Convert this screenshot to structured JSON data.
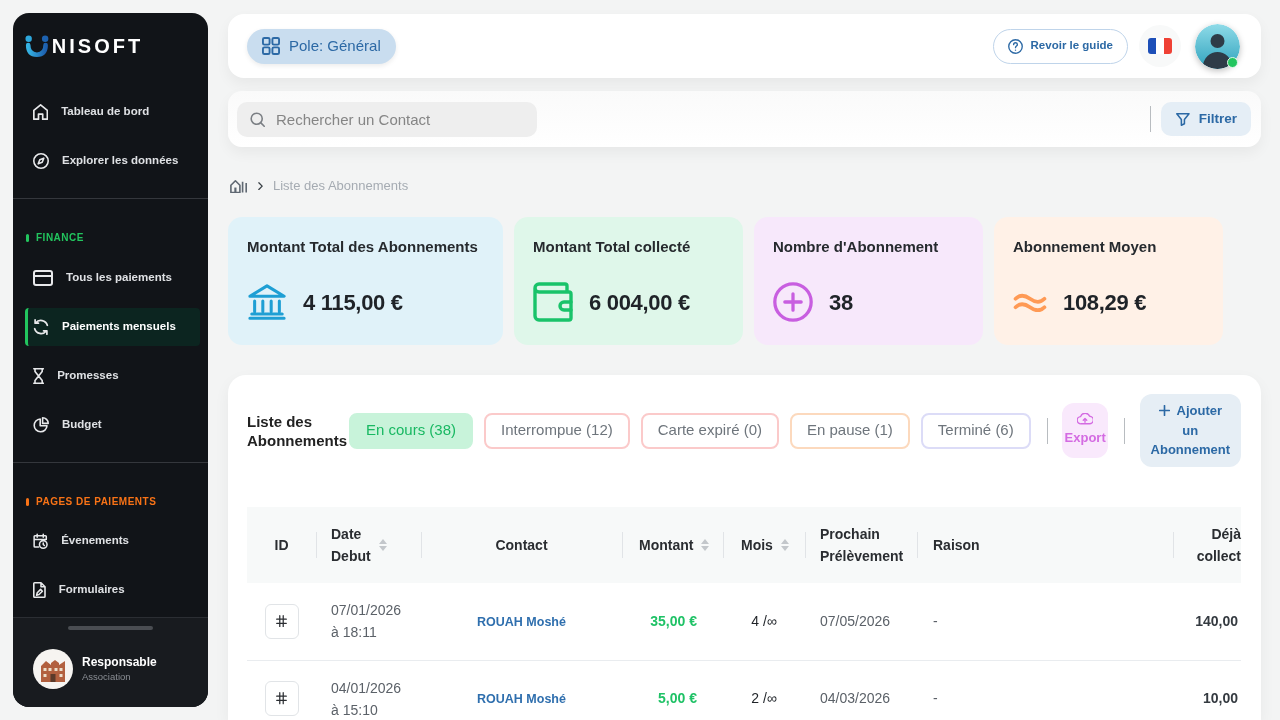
{
  "sidebar": {
    "logo": "NISOFT",
    "nav": [
      {
        "label": "Tableau de bord",
        "selected": false
      },
      {
        "label": "Explorer les données",
        "selected": false
      }
    ],
    "sections": [
      {
        "title": "FINANCE",
        "color": "#22c55e",
        "items": [
          {
            "label": "Tous les paiements",
            "selected": false
          },
          {
            "label": "Paiements mensuels",
            "selected": true
          },
          {
            "label": "Promesses",
            "selected": false
          },
          {
            "label": "Budget",
            "selected": false
          }
        ]
      },
      {
        "title": "PAGES DE PAIEMENTS",
        "color": "#f97316",
        "items": [
          {
            "label": "Évenements",
            "selected": false
          },
          {
            "label": "Formulaires",
            "selected": false
          }
        ]
      }
    ],
    "user": {
      "name": "Responsable",
      "role": "Association"
    }
  },
  "header": {
    "pole_button": "Pole: Général",
    "guide_button": "Revoir le guide",
    "user_online": true
  },
  "search": {
    "placeholder": "Rechercher un Contact",
    "filter_button": "Filtrer"
  },
  "breadcrumb": [
    "Liste des Abonnements"
  ],
  "stats": [
    {
      "title": "Montant Total des Abonnements",
      "value": "4 115,00 €",
      "color": "#1e9fd4"
    },
    {
      "title": "Montant Total collecté",
      "value": "6 004,00 €",
      "color": "#19c36a"
    },
    {
      "title": "Nombre d'Abonnement",
      "value": "38",
      "color": "#c85ee0"
    },
    {
      "title": "Abonnement Moyen",
      "value": "108,29 €",
      "color": "#ff9a55"
    }
  ],
  "subscriptions": {
    "title": "Liste des Abonnements",
    "tabs": [
      {
        "label": "En cours (38)",
        "selected": true,
        "color": "#c8f3da"
      },
      {
        "label": "Interrompue (12)",
        "selected": false,
        "color": "#fbcaca"
      },
      {
        "label": "Carte expiré (0)",
        "selected": false,
        "color": "#fbcaca"
      },
      {
        "label": "En pause (1)",
        "selected": false,
        "color": "#fcd9bd"
      },
      {
        "label": "Terminé (6)",
        "selected": false,
        "color": "#dcdcf7"
      }
    ],
    "export_button": "Export",
    "add_button": "Ajouter un Abonnement",
    "columns": [
      {
        "label": "ID",
        "sortable": false
      },
      {
        "label": "Date Debut",
        "sortable": true
      },
      {
        "label": "Contact",
        "sortable": false
      },
      {
        "label": "Montant",
        "sortable": true
      },
      {
        "label": "Mois",
        "sortable": true
      },
      {
        "label": "Prochain Prélèvement",
        "sortable": false
      },
      {
        "label": "Raison",
        "sortable": false
      },
      {
        "label": "Déjà collect",
        "sortable": false
      }
    ],
    "rows": [
      {
        "start": "07/01/2026 à 18:11",
        "contact": "ROUAH Moshé",
        "amount": "35,00 €",
        "months": "4 /∞",
        "next_debit": "07/05/2026",
        "reason": "-",
        "collected": "140,00"
      },
      {
        "start": "04/01/2026 à 15:10",
        "contact": "ROUAH Moshé",
        "amount": "5,00 €",
        "months": "2 /∞",
        "next_debit": "04/03/2026",
        "reason": "-",
        "collected": "10,00"
      }
    ]
  }
}
